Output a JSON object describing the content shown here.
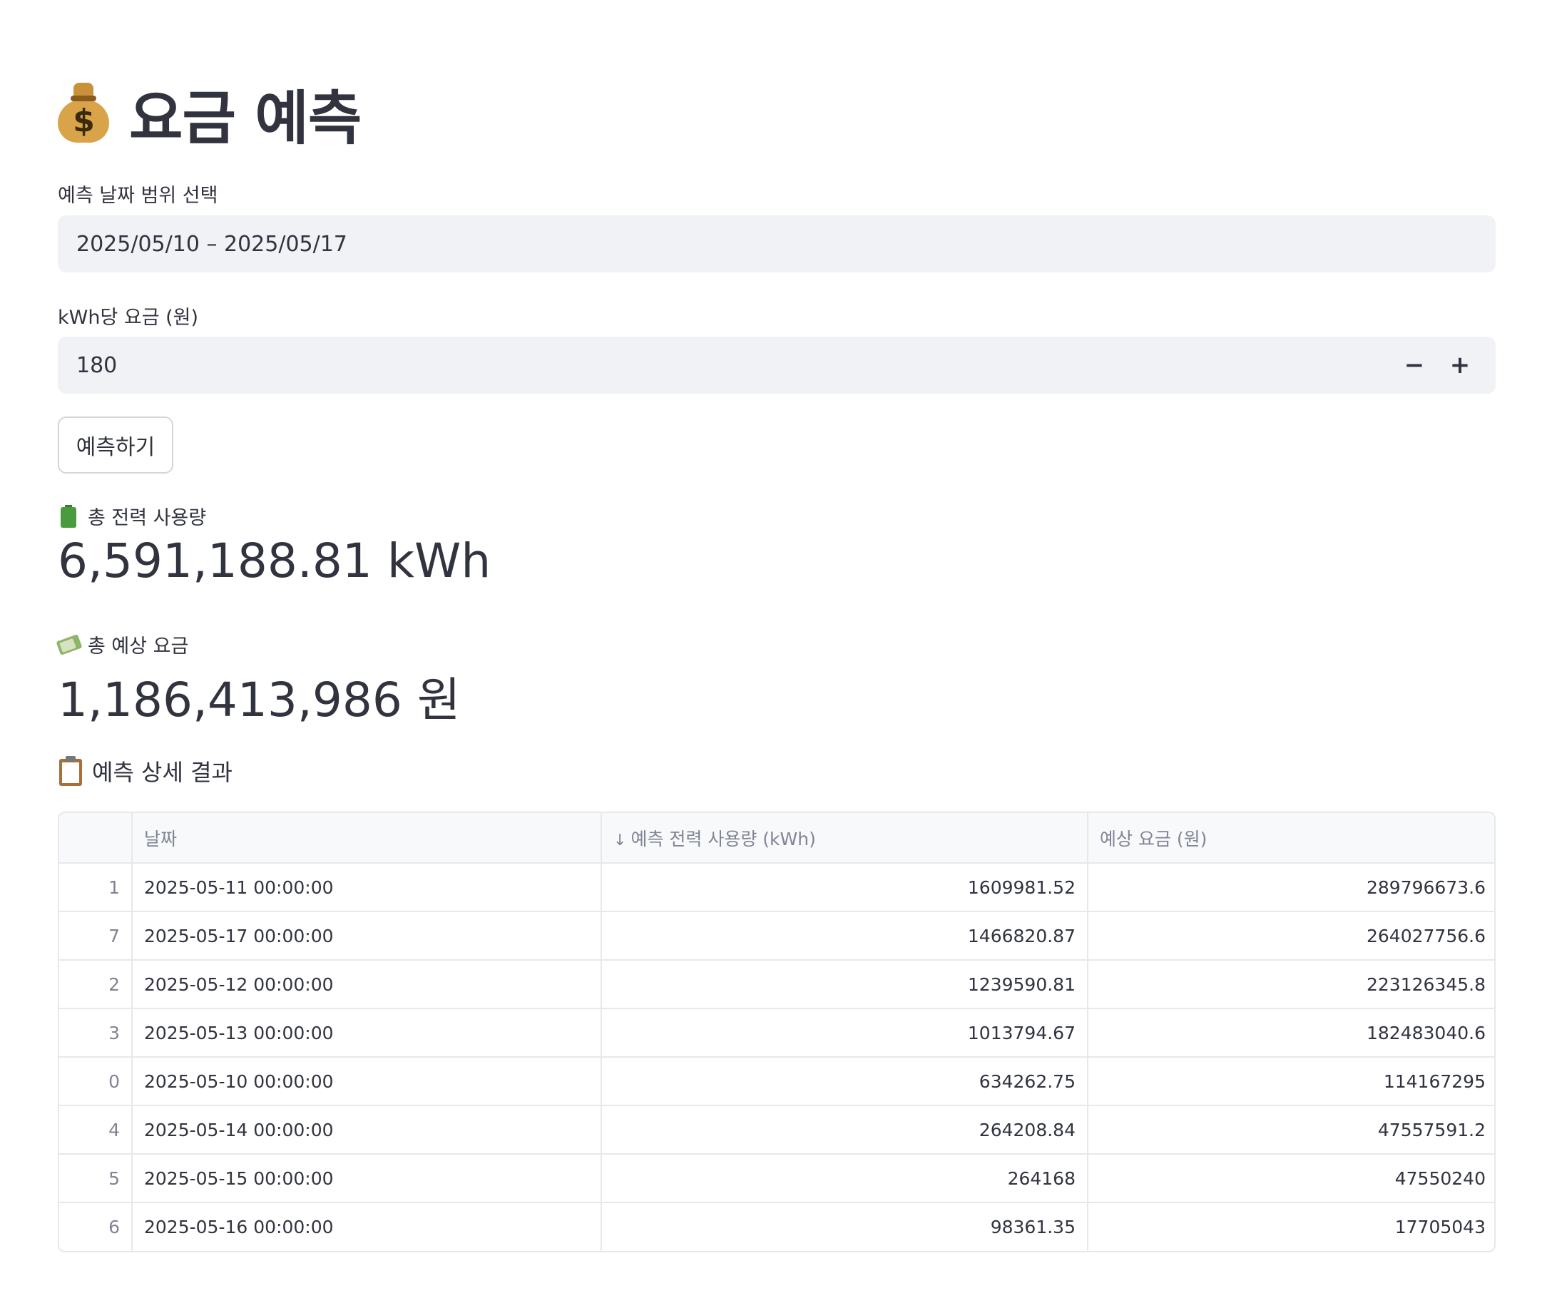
{
  "page": {
    "title": "요금 예측",
    "title_icon": "money-bag-icon"
  },
  "date_range": {
    "label": "예측 날짜 범위 선택",
    "value": "2025/05/10 – 2025/05/17"
  },
  "rate": {
    "label": "kWh당 요금 (원)",
    "value": "180",
    "decrement": "−",
    "increment": "+"
  },
  "predict_button": {
    "label": "예측하기"
  },
  "metrics": {
    "total_usage": {
      "icon": "battery-icon",
      "label": "총 전력 사용량",
      "value": "6,591,188.81 kWh"
    },
    "total_cost": {
      "icon": "money-with-wings-icon",
      "label": "총 예상 요금",
      "value": "1,186,413,986 원"
    }
  },
  "details": {
    "icon": "clipboard-icon",
    "heading": "예측 상세 결과",
    "columns": [
      "",
      "날짜",
      "예측 전력 사용량 (kWh)",
      "예상 요금 (원)"
    ],
    "sort_indicator": "↓",
    "rows": [
      {
        "index": "1",
        "date": "2025-05-11 00:00:00",
        "usage": "1609981.52",
        "cost": "289796673.6"
      },
      {
        "index": "7",
        "date": "2025-05-17 00:00:00",
        "usage": "1466820.87",
        "cost": "264027756.6"
      },
      {
        "index": "2",
        "date": "2025-05-12 00:00:00",
        "usage": "1239590.81",
        "cost": "223126345.8"
      },
      {
        "index": "3",
        "date": "2025-05-13 00:00:00",
        "usage": "1013794.67",
        "cost": "182483040.6"
      },
      {
        "index": "0",
        "date": "2025-05-10 00:00:00",
        "usage": "634262.75",
        "cost": "114167295"
      },
      {
        "index": "4",
        "date": "2025-05-14 00:00:00",
        "usage": "264208.84",
        "cost": "47557591.2"
      },
      {
        "index": "5",
        "date": "2025-05-15 00:00:00",
        "usage": "264168",
        "cost": "47550240"
      },
      {
        "index": "6",
        "date": "2025-05-16 00:00:00",
        "usage": "98361.35",
        "cost": "17705043"
      }
    ]
  }
}
